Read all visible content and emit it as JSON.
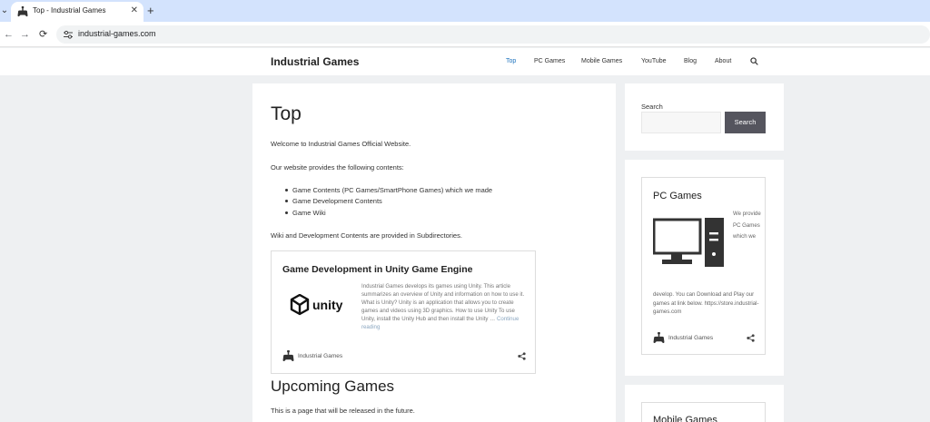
{
  "browser": {
    "tab_title": "Top - Industrial Games",
    "tab_close": "✕",
    "new_tab": "+",
    "back": "←",
    "forward": "→",
    "reload": "⟳",
    "url": "industrial-games.com"
  },
  "site": {
    "logo": "Industrial Games",
    "nav": [
      "Top",
      "PC Games",
      "Mobile Games",
      "YouTube",
      "Blog",
      "About"
    ],
    "nav_active_color": "#1e73be"
  },
  "main": {
    "title": "Top",
    "welcome": "Welcome to Industrial Games Official Website.",
    "provides": "Our website provides the following contents:",
    "list": [
      "Game Contents (PC Games/SmartPhone Games) which we made",
      "Game Development Contents",
      "Game Wiki"
    ],
    "subdirs": "Wiki and Development Contents are provided in Subdirectories.",
    "card": {
      "title": "Game Development in Unity Game Engine",
      "logo_text": "unity",
      "excerpt": "Industrial Games develops its games using Unity. This article summarizes an overview of Unity and information on how to use it. What is Unity? Unity is an application that allows you to create games and videos using 3D graphics. How to use Unity To use Unity, install the Unity Hub and then install the Unity …",
      "more": "Continue reading",
      "author": "Industrial Games"
    },
    "upcoming_title": "Upcoming Games",
    "upcoming_text": "This is a page that will be released in the future."
  },
  "sidebar": {
    "search_label": "Search",
    "search_button": "Search",
    "pc_title": "PC Games",
    "pc_side_text": "We provide PC Games which we",
    "pc_text": "develop. You can Download and Play our games at link below. https://store.industrial-games.com",
    "pc_author": "Industrial Games",
    "mobile_title": "Mobile Games"
  }
}
